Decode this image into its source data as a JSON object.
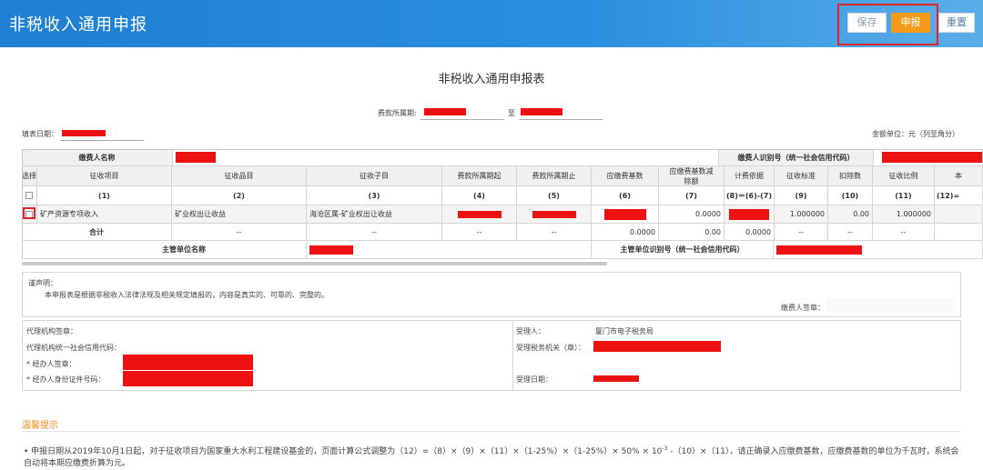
{
  "header": {
    "title": "非税收入通用申报",
    "buttons": {
      "save": "保存",
      "submit": "申报",
      "reset": "重置"
    }
  },
  "form": {
    "title": "非税收入通用申报表",
    "period_label": "费款所属期:",
    "period_to": "至",
    "fill_date_label": "填表日期：",
    "amount_unit": "金额单位：元（列至角分）"
  },
  "table": {
    "payer_name_label": "缴费人名称",
    "payer_id_label": "缴费人识别号（统一社会信用代码）",
    "headers": [
      "选择",
      "征收项目",
      "征收品目",
      "征收子目",
      "费款所属期起",
      "费款所属期止",
      "应缴费基数",
      "应缴费基数减除额",
      "计费依据",
      "征收标准",
      "扣除数",
      "征收比例",
      "本"
    ],
    "col_codes": [
      "(1)",
      "(2)",
      "(3)",
      "(4)",
      "(5)",
      "(6)",
      "(7)",
      "(8)＝(6)-(7)",
      "(9)",
      "(10)",
      "(11)",
      "(12)="
    ],
    "row": {
      "item": "矿产资源专项收入",
      "category": "矿业权出让收益",
      "subitem": "海沧区属-矿业权出让收益",
      "deduction_base": "0.0000",
      "standard": "1.000000",
      "deduct": "0.00",
      "ratio": "1.000000"
    },
    "total": {
      "label": "合计",
      "dash": "--",
      "base": "0.0000",
      "deduction": "0.00",
      "basis": "0.0000"
    },
    "supervisor_name_label": "主管单位名称",
    "supervisor_id_label": "主管单位识别号（统一社会信用代码）"
  },
  "declaration": {
    "title": "谨声明：",
    "text": "本申报表是根据非税收入法律法规及相关规定填报的，内容是真实的、可靠的、完整的。",
    "payer_sign": "缴费人签章："
  },
  "agent": {
    "agency_sign": "代理机构签章：",
    "agency_code": "代理机构统一社会信用代码：",
    "handler_sign": "* 经办人签章：",
    "handler_id": "* 经办人身份证件号码：",
    "receiver_label": "受理人：",
    "receiver_value": "厦门市电子税务局",
    "tax_office_label": "受理税务机关（章）：",
    "accept_date_label": "受理日期："
  },
  "tips": {
    "title": "温馨提示",
    "text_a": "申报日期从2019年10月1日起，对于征收项目为国家重大水利工程建设基金的，页面计算公式调整为（12）=（8）×（9）×（11）×（1-25%）×（1-25%）× 50% × 10",
    "text_sup": "-3",
    "text_b": " -（10）×（11），请正确录入应缴费基数，应缴费基数的单位为千瓦时，系统会自动将本期应缴费折算为元。"
  }
}
